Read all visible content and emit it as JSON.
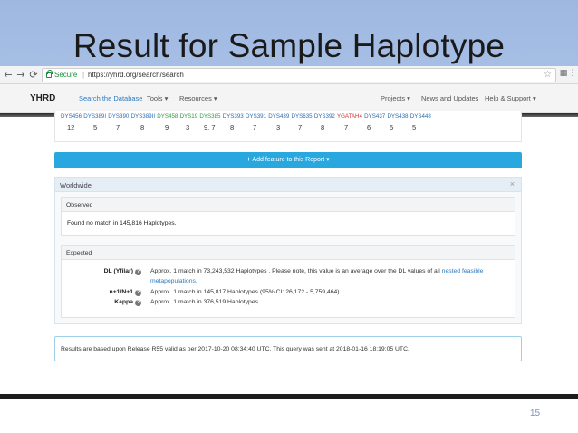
{
  "slide": {
    "title": "Result for Sample Haplotype",
    "page_number": "15"
  },
  "browser": {
    "back": "←",
    "forward": "→",
    "reload": "⟳",
    "secure_label": "Secure",
    "url": "https://yhrd.org/search/search",
    "star": "☆"
  },
  "navbar": {
    "brand": "YHRD",
    "items": [
      {
        "label": "Search the Database",
        "active": true
      },
      {
        "label": "Tools ▾",
        "active": false
      },
      {
        "label": "Resources ▾",
        "active": false
      },
      {
        "label": "Projects ▾",
        "active": false
      },
      {
        "label": "News and Updates",
        "active": false
      },
      {
        "label": "Help & Support ▾",
        "active": false
      }
    ]
  },
  "markers": {
    "names": [
      {
        "name": "DYS456",
        "color": "blue"
      },
      {
        "name": "DYS389I",
        "color": "blue"
      },
      {
        "name": "DYS390",
        "color": "blue"
      },
      {
        "name": "DYS389II",
        "color": "blue"
      },
      {
        "name": "DYS458",
        "color": "green"
      },
      {
        "name": "DYS19",
        "color": "green"
      },
      {
        "name": "DYS385",
        "color": "green"
      },
      {
        "name": "DYS393",
        "color": "blue"
      },
      {
        "name": "DYS391",
        "color": "blue"
      },
      {
        "name": "DYS439",
        "color": "blue"
      },
      {
        "name": "DYS635",
        "color": "blue"
      },
      {
        "name": "DYS392",
        "color": "blue"
      },
      {
        "name": "YGATAH4",
        "color": "red"
      },
      {
        "name": "DYS437",
        "color": "blue"
      },
      {
        "name": "DYS438",
        "color": "blue"
      },
      {
        "name": "DYS448",
        "color": "blue"
      }
    ],
    "values": [
      "12",
      "5",
      "7",
      "8",
      "9",
      "3",
      "9, 7",
      "8",
      "7",
      "3",
      "7",
      "8",
      "7",
      "6",
      "5",
      "5"
    ]
  },
  "add_feature": {
    "plus": "+",
    "label": "Add feature to this Report ▾"
  },
  "worldwide": {
    "title": "Worldwide",
    "close": "×",
    "observed": {
      "title": "Observed",
      "text": "Found no match in 145,816 Haplotypes."
    },
    "expected": {
      "title": "Expected",
      "rows": [
        {
          "label": "DL (Yfilar)",
          "text": "Approx. 1 match in 73,243,532 Haplotypes . Please note, this value is an average over the DL values of all",
          "link": "nested feasible",
          "text2": "metapopulations."
        },
        {
          "label": "n+1/N+1",
          "text": "Approx. 1 match in 145,817 Haplotypes (95% CI: 26,172 - 5,759,464)"
        },
        {
          "label": "Kappa",
          "text": "Approx. 1 match in 376,519 Haplotypes"
        }
      ]
    }
  },
  "release_info": "Results are based upon Release R55 valid as per 2017-10-20 08:34:40 UTC. This query was sent at 2018-01-16 18:19:05 UTC."
}
